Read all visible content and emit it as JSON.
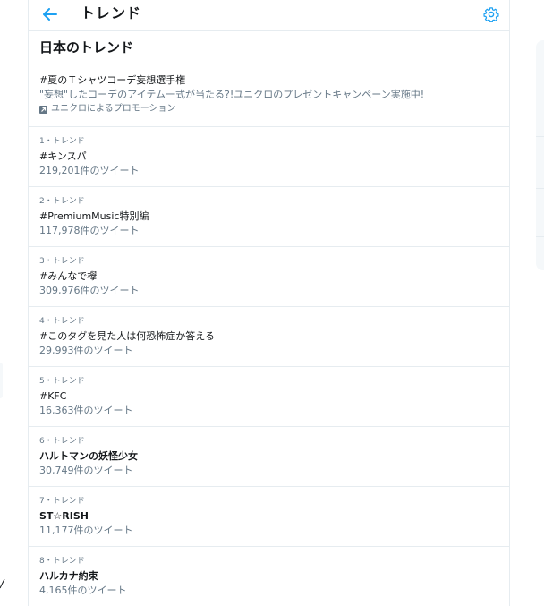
{
  "header": {
    "title": "トレンド",
    "back_icon": "arrow-left-icon",
    "settings_icon": "gear-icon",
    "accent_color": "#1da1f2"
  },
  "section": {
    "title": "日本のトレンド"
  },
  "promo": {
    "hashtag": "#夏のＴシャツコーデ妄想選手権",
    "description": "\"妄想\"したコーデのアイテム一式が当たる?!ユニクロのプレゼントキャンペーン実施中!",
    "promoted_by": "ユニクロによるプロモーション",
    "promoted_icon": "promoted-icon"
  },
  "trends": [
    {
      "meta": "1・トレンド",
      "name": "#キンスパ",
      "count": "219,201件のツイート"
    },
    {
      "meta": "2・トレンド",
      "name": "#PremiumMusic特別編",
      "count": "117,978件のツイート"
    },
    {
      "meta": "3・トレンド",
      "name": "#みんなで欅",
      "count": "309,976件のツイート"
    },
    {
      "meta": "4・トレンド",
      "name": "#このタグを見た人は何恐怖症か答える",
      "count": "29,993件のツイート"
    },
    {
      "meta": "5・トレンド",
      "name": "#KFC",
      "count": "16,363件のツイート"
    },
    {
      "meta": "6・トレンド",
      "name": "ハルトマンの妖怪少女",
      "count": "30,749件のツイート"
    },
    {
      "meta": "7・トレンド",
      "name": "ST☆RISH",
      "count": "11,177件のツイート"
    },
    {
      "meta": "8・トレンド",
      "name": "ハルカナ約束",
      "count": "4,165件のツイート"
    }
  ]
}
